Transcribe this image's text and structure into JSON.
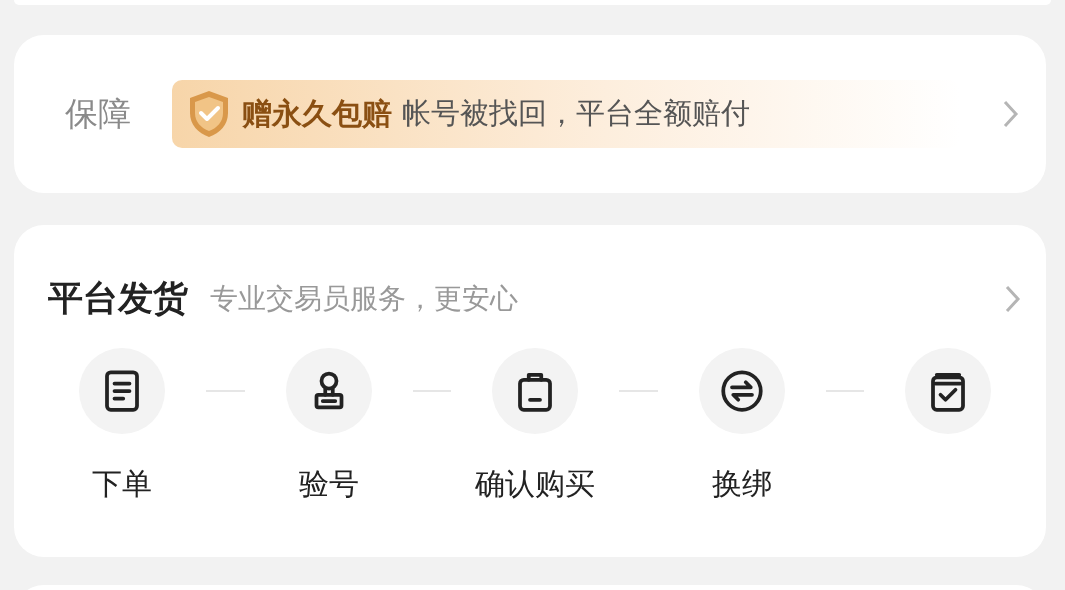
{
  "guarantee": {
    "label": "保障",
    "badge": "赠永久包赔",
    "text": "帐号被找回，平台全额赔付"
  },
  "delivery": {
    "title": "平台发货",
    "subtitle": "专业交易员服务，更安心",
    "steps": [
      {
        "kind": "document",
        "label": "下单"
      },
      {
        "kind": "stamp",
        "label": "验号"
      },
      {
        "kind": "bag",
        "label": "确认购买"
      },
      {
        "kind": "swap",
        "label": "换绑"
      },
      {
        "kind": "box-check"
      }
    ]
  }
}
